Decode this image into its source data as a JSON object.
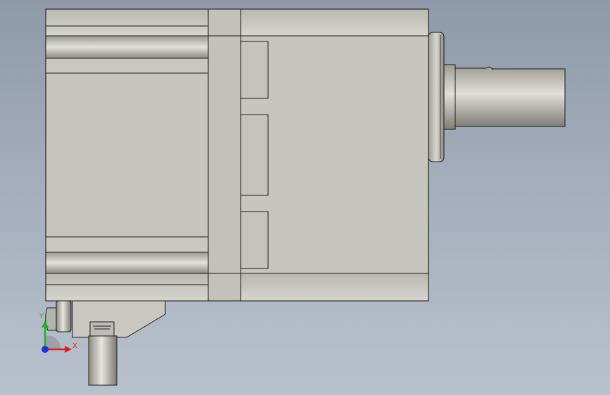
{
  "viewport": {
    "background_top": "#8f9aa9",
    "background_bottom": "#b9c1cd"
  },
  "model": {
    "body_fill": "#c6c6be",
    "edge_color": "#1a1a1a",
    "shaft_fill": "#c3c3bb"
  },
  "triad": {
    "x_label": "X",
    "y_label": "Y",
    "x_color": "#e02020",
    "y_color": "#20b020",
    "z_color": "#2030e0"
  }
}
